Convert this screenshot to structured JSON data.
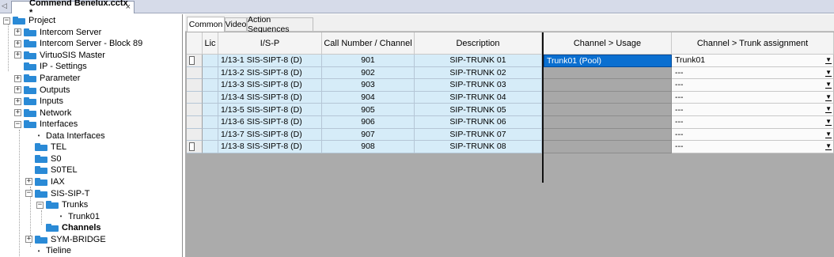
{
  "doc_tab": {
    "title": "Commend Benelux.cctx *",
    "close": "×"
  },
  "tree": {
    "items": [
      {
        "label": "Project",
        "expander": "⊟",
        "kind": "folder"
      },
      {
        "label": "Intercom Server",
        "expander": "⊞",
        "kind": "folder"
      },
      {
        "label": "Intercom Server - Block 89",
        "expander": "⊞",
        "kind": "folder"
      },
      {
        "label": "VirtuoSIS Master",
        "expander": "⊞",
        "kind": "folder"
      },
      {
        "label": "IP - Settings",
        "expander": "",
        "kind": "folder"
      },
      {
        "label": "Parameter",
        "expander": "⊞",
        "kind": "folder"
      },
      {
        "label": "Outputs",
        "expander": "⊞",
        "kind": "folder"
      },
      {
        "label": "Inputs",
        "expander": "⊞",
        "kind": "folder"
      },
      {
        "label": "Network",
        "expander": "⊞",
        "kind": "folder"
      },
      {
        "label": "Interfaces",
        "expander": "⊟",
        "kind": "folder"
      },
      {
        "label": "Data Interfaces",
        "expander": "",
        "kind": "bullet"
      },
      {
        "label": "TEL",
        "expander": "",
        "kind": "folder"
      },
      {
        "label": "S0",
        "expander": "",
        "kind": "folder"
      },
      {
        "label": "S0TEL",
        "expander": "",
        "kind": "folder"
      },
      {
        "label": "IAX",
        "expander": "⊞",
        "kind": "folder"
      },
      {
        "label": "SIS-SIP-T",
        "expander": "⊟",
        "kind": "folder"
      },
      {
        "label": "Trunks",
        "expander": "⊟",
        "kind": "folder"
      },
      {
        "label": "Trunk01",
        "expander": "",
        "kind": "bullet"
      },
      {
        "label": "Channels",
        "expander": "",
        "kind": "folder"
      },
      {
        "label": "SYM-BRIDGE",
        "expander": "⊞",
        "kind": "folder"
      },
      {
        "label": "Tieline",
        "expander": "",
        "kind": "bullet"
      }
    ]
  },
  "subtabs": [
    "Common",
    "Video",
    "Action Sequences"
  ],
  "table": {
    "headers": [
      "Lic",
      "I/S-P",
      "Call Number / Channel",
      "Description",
      "Channel > Usage",
      "Channel > Trunk assignment"
    ],
    "rows": [
      {
        "isp": "1/13-1  SIS-SIPT-8 (D)",
        "call": "901",
        "desc": "SIP-TRUNK 01",
        "usage": "Trunk01 (Pool)",
        "trunk": "Trunk01"
      },
      {
        "isp": "1/13-2  SIS-SIPT-8 (D)",
        "call": "902",
        "desc": "SIP-TRUNK 02",
        "usage": "",
        "trunk": "---"
      },
      {
        "isp": "1/13-3  SIS-SIPT-8 (D)",
        "call": "903",
        "desc": "SIP-TRUNK 03",
        "usage": "",
        "trunk": "---"
      },
      {
        "isp": "1/13-4  SIS-SIPT-8 (D)",
        "call": "904",
        "desc": "SIP-TRUNK 04",
        "usage": "",
        "trunk": "---"
      },
      {
        "isp": "1/13-5  SIS-SIPT-8 (D)",
        "call": "905",
        "desc": "SIP-TRUNK 05",
        "usage": "",
        "trunk": "---"
      },
      {
        "isp": "1/13-6  SIS-SIPT-8 (D)",
        "call": "906",
        "desc": "SIP-TRUNK 06",
        "usage": "",
        "trunk": "---"
      },
      {
        "isp": "1/13-7  SIS-SIPT-8 (D)",
        "call": "907",
        "desc": "SIP-TRUNK 07",
        "usage": "",
        "trunk": "---"
      },
      {
        "isp": "1/13-8  SIS-SIPT-8 (D)",
        "call": "908",
        "desc": "SIP-TRUNK 08",
        "usage": "",
        "trunk": "---"
      }
    ]
  },
  "colors": {
    "selection": "#0a6fd0",
    "folder": "#2a8ad6",
    "row_blue": "#d6ecf8",
    "panel_gray": "#ababab"
  }
}
